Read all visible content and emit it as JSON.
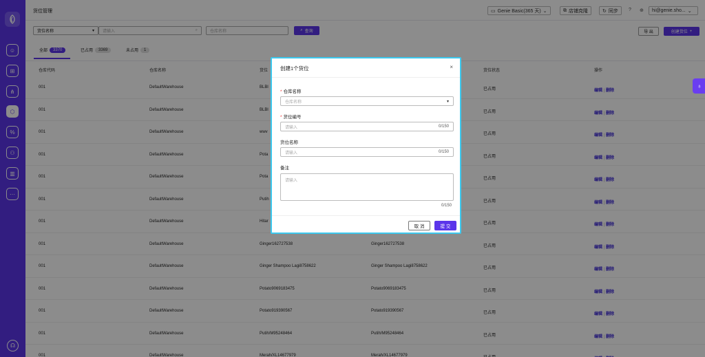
{
  "topbar": {
    "title": "货位管理",
    "plan": "Genie Basic(365 天)",
    "store_clone": "店铺克隆",
    "sync": "同步",
    "user": "hi@genie.sho..."
  },
  "filter": {
    "select_value": "货位名称",
    "search_placeholder": "请输入",
    "warehouse_placeholder": "仓库名称",
    "query_label": "查询",
    "export_label": "导 出",
    "create_label": "创建货位"
  },
  "tabs": [
    {
      "label": "全部",
      "count": "3370"
    },
    {
      "label": "已占用",
      "count": "3369"
    },
    {
      "label": "未占用",
      "count": "1"
    }
  ],
  "table": {
    "headers": [
      "仓库代码",
      "仓库名称",
      "货位",
      "",
      "货位状态",
      "操作"
    ],
    "edit_label": "编辑",
    "delete_label": "删除",
    "rows": [
      {
        "code": "001",
        "warehouse": "DefaultWarehouse",
        "loc": "BLBl",
        "name": "",
        "status": "已占用"
      },
      {
        "code": "001",
        "warehouse": "DefaultWarehouse",
        "loc": "BLBl",
        "name": "",
        "status": "已占用"
      },
      {
        "code": "001",
        "warehouse": "DefaultWarehouse",
        "loc": "wwv",
        "name": "",
        "status": "已占用"
      },
      {
        "code": "001",
        "warehouse": "DefaultWarehouse",
        "loc": "Pota",
        "name": "",
        "status": "已占用"
      },
      {
        "code": "001",
        "warehouse": "DefaultWarehouse",
        "loc": "Pota",
        "name": "",
        "status": "已占用"
      },
      {
        "code": "001",
        "warehouse": "DefaultWarehouse",
        "loc": "Putih",
        "name": "",
        "status": "已占用"
      },
      {
        "code": "001",
        "warehouse": "DefaultWarehouse",
        "loc": "Hitar",
        "name": "",
        "status": "已占用"
      },
      {
        "code": "001",
        "warehouse": "DefaultWarehouse",
        "loc": "Ginger162727538",
        "name": "Ginger162727538",
        "status": "已占用"
      },
      {
        "code": "001",
        "warehouse": "DefaultWarehouse",
        "loc": "Ginger Shampoo Lagi8758622",
        "name": "Ginger Shampoo Lagi8758622",
        "status": "已占用"
      },
      {
        "code": "001",
        "warehouse": "DefaultWarehouse",
        "loc": "Potato9069183475",
        "name": "Potato9069183475",
        "status": "已占用"
      },
      {
        "code": "001",
        "warehouse": "DefaultWarehouse",
        "loc": "Potato919390567",
        "name": "Potato919390567",
        "status": "已占用"
      },
      {
        "code": "001",
        "warehouse": "DefaultWarehouse",
        "loc": "Putih/M95248464",
        "name": "Putih/M95248464",
        "status": "已占用"
      },
      {
        "code": "001",
        "warehouse": "DefaultWarehouse",
        "loc": "Merah/XL14677979",
        "name": "Merah/XL14677979",
        "status": "已占用"
      }
    ]
  },
  "modal": {
    "title": "创建1个货位",
    "warehouse_label": "仓库名称",
    "warehouse_placeholder": "仓库名称",
    "code_label": "货位编号",
    "code_placeholder": "请输入",
    "code_count": "0/150",
    "name_label": "货位名称",
    "name_placeholder": "请输入",
    "name_count": "0/150",
    "note_label": "备注",
    "note_placeholder": "请输入",
    "note_count": "0/150",
    "cancel_label": "取 消",
    "submit_label": "提 交"
  },
  "colors": {
    "accent": "#5b35ea",
    "modal_border": "#3cc9ef"
  }
}
